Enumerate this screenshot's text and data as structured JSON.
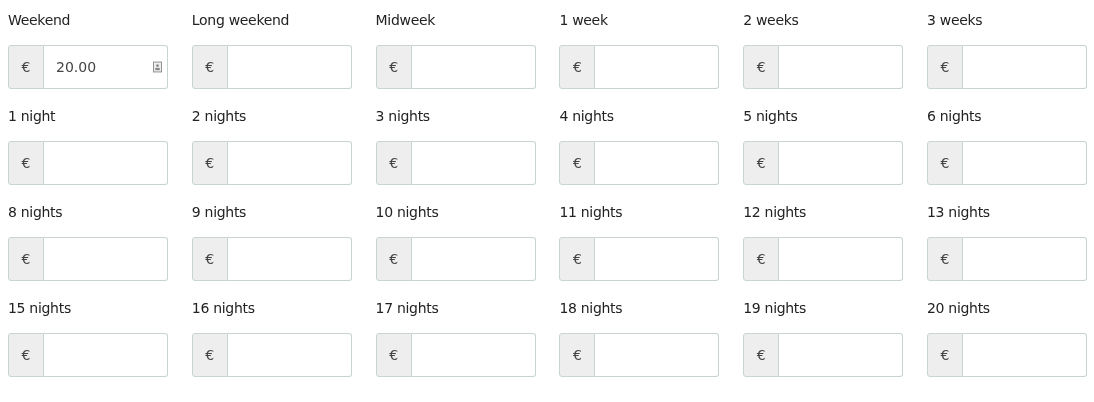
{
  "price_fields": [
    {
      "label": "Weekend",
      "prefix": "€",
      "value": "20.00",
      "autofill_icon": true
    },
    {
      "label": "Long weekend",
      "prefix": "€"
    },
    {
      "label": "Midweek",
      "prefix": "€"
    },
    {
      "label": "1 week",
      "prefix": "€"
    },
    {
      "label": "2 weeks",
      "prefix": "€"
    },
    {
      "label": "3 weeks",
      "prefix": "€"
    },
    {
      "label": "1 night",
      "prefix": "€"
    },
    {
      "label": "2 nights",
      "prefix": "€"
    },
    {
      "label": "3 nights",
      "prefix": "€"
    },
    {
      "label": "4 nights",
      "prefix": "€"
    },
    {
      "label": "5 nights",
      "prefix": "€"
    },
    {
      "label": "6 nights",
      "prefix": "€"
    },
    {
      "label": "8 nights",
      "prefix": "€"
    },
    {
      "label": "9 nights",
      "prefix": "€"
    },
    {
      "label": "10 nights",
      "prefix": "€"
    },
    {
      "label": "11 nights",
      "prefix": "€"
    },
    {
      "label": "12 nights",
      "prefix": "€"
    },
    {
      "label": "13 nights",
      "prefix": "€"
    },
    {
      "label": "15 nights",
      "prefix": "€"
    },
    {
      "label": "16 nights",
      "prefix": "€"
    },
    {
      "label": "17 nights",
      "prefix": "€"
    },
    {
      "label": "18 nights",
      "prefix": "€"
    },
    {
      "label": "19 nights",
      "prefix": "€"
    },
    {
      "label": "20 nights",
      "prefix": "€"
    }
  ]
}
